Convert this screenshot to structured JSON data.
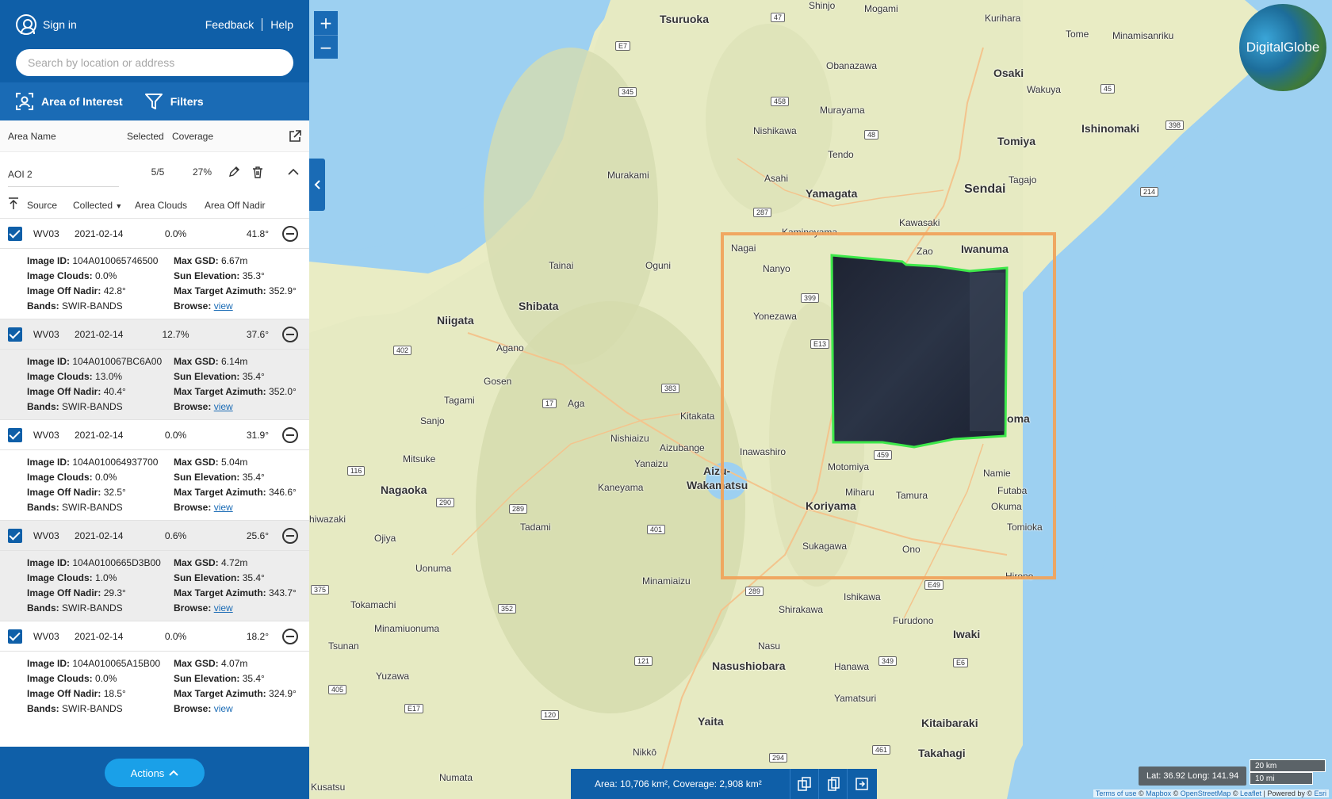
{
  "header": {
    "signin": "Sign in",
    "feedback": "Feedback",
    "help": "Help",
    "search_placeholder": "Search by location or address"
  },
  "toolbar": {
    "aoi": "Area of Interest",
    "filters": "Filters"
  },
  "area_table": {
    "headers": {
      "name": "Area Name",
      "selected": "Selected",
      "coverage": "Coverage"
    },
    "row": {
      "name": "AOI 2",
      "selected": "5/5",
      "coverage": "27%"
    }
  },
  "scene_headers": {
    "source": "Source",
    "collected": "Collected",
    "clouds": "Area Clouds",
    "nadir": "Area Off Nadir"
  },
  "scenes": [
    {
      "source": "WV03",
      "date": "2021-02-14",
      "clouds": "0.0%",
      "nadir": "41.8°",
      "image_id": "104A010065746500",
      "max_gsd": "6.67m",
      "image_clouds": "0.0%",
      "sun_elev": "35.3°",
      "image_nadir": "42.8°",
      "azimuth": "352.9°",
      "bands": "SWIR-BANDS",
      "browse": "view"
    },
    {
      "source": "WV03",
      "date": "2021-02-14",
      "clouds": "12.7%",
      "nadir": "37.6°",
      "image_id": "104A010067BC6A00",
      "max_gsd": "6.14m",
      "image_clouds": "13.0%",
      "sun_elev": "35.4°",
      "image_nadir": "40.4°",
      "azimuth": "352.0°",
      "bands": "SWIR-BANDS",
      "browse": "view"
    },
    {
      "source": "WV03",
      "date": "2021-02-14",
      "clouds": "0.0%",
      "nadir": "31.9°",
      "image_id": "104A010064937700",
      "max_gsd": "5.04m",
      "image_clouds": "0.0%",
      "sun_elev": "35.4°",
      "image_nadir": "32.5°",
      "azimuth": "346.6°",
      "bands": "SWIR-BANDS",
      "browse": "view"
    },
    {
      "source": "WV03",
      "date": "2021-02-14",
      "clouds": "0.6%",
      "nadir": "25.6°",
      "image_id": "104A0100665D3B00",
      "max_gsd": "4.72m",
      "image_clouds": "1.0%",
      "sun_elev": "35.4°",
      "image_nadir": "29.3°",
      "azimuth": "343.7°",
      "bands": "SWIR-BANDS",
      "browse": "view"
    },
    {
      "source": "WV03",
      "date": "2021-02-14",
      "clouds": "0.0%",
      "nadir": "18.2°",
      "image_id": "104A010065A15B00",
      "max_gsd": "4.07m",
      "image_clouds": "0.0%",
      "sun_elev": "35.4°",
      "image_nadir": "18.5°",
      "azimuth": "324.9°",
      "bands": "SWIR-BANDS",
      "browse": "view"
    }
  ],
  "detail_labels": {
    "image_id": "Image ID:",
    "max_gsd": "Max GSD:",
    "image_clouds": "Image Clouds:",
    "sun_elev": "Sun Elevation:",
    "image_nadir": "Image Off Nadir:",
    "azimuth": "Max Target Azimuth:",
    "bands": "Bands:",
    "browse": "Browse:"
  },
  "footer": {
    "actions": "Actions"
  },
  "map": {
    "logo": "DigitalGlobe",
    "status": "Area: 10,706 km², Coverage: 2,908 km²",
    "coords": "Lat: 36.92 Long: 141.94",
    "scale_km": "20 km",
    "scale_mi": "10 mi",
    "attribution": {
      "terms": "Terms of use",
      "mapbox": "Mapbox",
      "osm": "OpenStreetMap",
      "leaflet": "Leaflet",
      "powered": "Powered by",
      "esri": "Esri"
    },
    "labels": {
      "tsuruoka": "Tsuruoka",
      "shinjo": "Shinjo",
      "mogami": "Mogami",
      "kurihara": "Kurihara",
      "tome": "Tome",
      "minamisanriku": "Minamisanriku",
      "obanazawa": "Obanazawa",
      "osaki": "Osaki",
      "wakuya": "Wakuya",
      "murayama": "Murayama",
      "ishinomaki": "Ishinomaki",
      "nishikawa": "Nishikawa",
      "tomiya": "Tomiya",
      "tendo": "Tendo",
      "murakami": "Murakami",
      "asahi": "Asahi",
      "tagajo": "Tagajo",
      "sendai": "Sendai",
      "yamagata": "Yamagata",
      "kawasaki": "Kawasaki",
      "kaminoyama": "Kaminoyama",
      "nagai": "Nagai",
      "zao": "Zao",
      "iwanuma": "Iwanuma",
      "tainai": "Tainai",
      "oguni": "Oguni",
      "nanyo": "Nanyo",
      "niigata": "Niigata",
      "shibata": "Shibata",
      "yonezawa": "Yonezawa",
      "agano": "Agano",
      "gosen": "Gosen",
      "tagami": "Tagami",
      "aga": "Aga",
      "kitakata": "Kitakata",
      "sanjo": "Sanjo",
      "nishiaizu": "Nishiaizu",
      "aizubange": "Aizubange",
      "inawashiro": "Inawashiro",
      "mitsuke": "Mitsuke",
      "yanaizu": "Yanaizu",
      "aizu": "Aizu-",
      "wakamatsu": "Wakamatsu",
      "motomiya": "Motomiya",
      "nagaoka": "Nagaoka",
      "kaneyama": "Kaneyama",
      "miharu": "Miharu",
      "tamura": "Tamura",
      "namie": "Namie",
      "futaba": "Futaba",
      "soma": "Minamisoma",
      "koriyama": "Koriyama",
      "okuma": "Okuma",
      "ojiya": "Ojiya",
      "tadami": "Tadami",
      "tomioka": "Tomioka",
      "kashiwazaki": "hiwazaki",
      "sukagawa": "Sukagawa",
      "ono": "Ono",
      "uonuma": "Uonuma",
      "minamiaizu": "Minamiaizu",
      "hirono": "Hirono",
      "ishikawa": "Ishikawa",
      "tokamachi": "Tokamachi",
      "shirakawa": "Shirakawa",
      "minamiuonuma": "Minamiuonuma",
      "furudono": "Furudono",
      "iwaki": "Iwaki",
      "tsunan": "Tsunan",
      "nasu": "Nasu",
      "hanawa": "Hanawa",
      "nasushiobara": "Nasushiobara",
      "yuzawa": "Yuzawa",
      "yamatsuri": "Yamatsuri",
      "yaita": "Yaita",
      "kitaibaraki": "Kitaibaraki",
      "nikko": "Nikkō",
      "takahagi": "Takahagi",
      "numata": "Numata",
      "kusatsu": "Kusatsu",
      "hi": "hi",
      "ta": "a"
    },
    "routes": {
      "r47": "47",
      "r7": "E7",
      "r345": "345",
      "r458": "458",
      "r48": "48",
      "r45": "45",
      "r398": "398",
      "r287": "287",
      "r214": "214",
      "r399": "399",
      "r402": "402",
      "r13": "E13",
      "r383": "383",
      "r17": "17",
      "r116": "116",
      "r459": "459",
      "r290": "290",
      "r289": "289",
      "r401": "401",
      "r375": "375",
      "r352": "352",
      "r289b": "289",
      "r49": "E49",
      "r121": "121",
      "r349": "349",
      "r6": "E6",
      "r405": "405",
      "r17b": "E17",
      "r120": "120",
      "r461": "461",
      "r294": "294"
    }
  },
  "colors": {
    "primary": "#0f5fa8",
    "accent": "#1aa0e8",
    "aoi": "#f0a35c",
    "image_border": "#3ee84a",
    "sea": "#9dd0f1"
  }
}
